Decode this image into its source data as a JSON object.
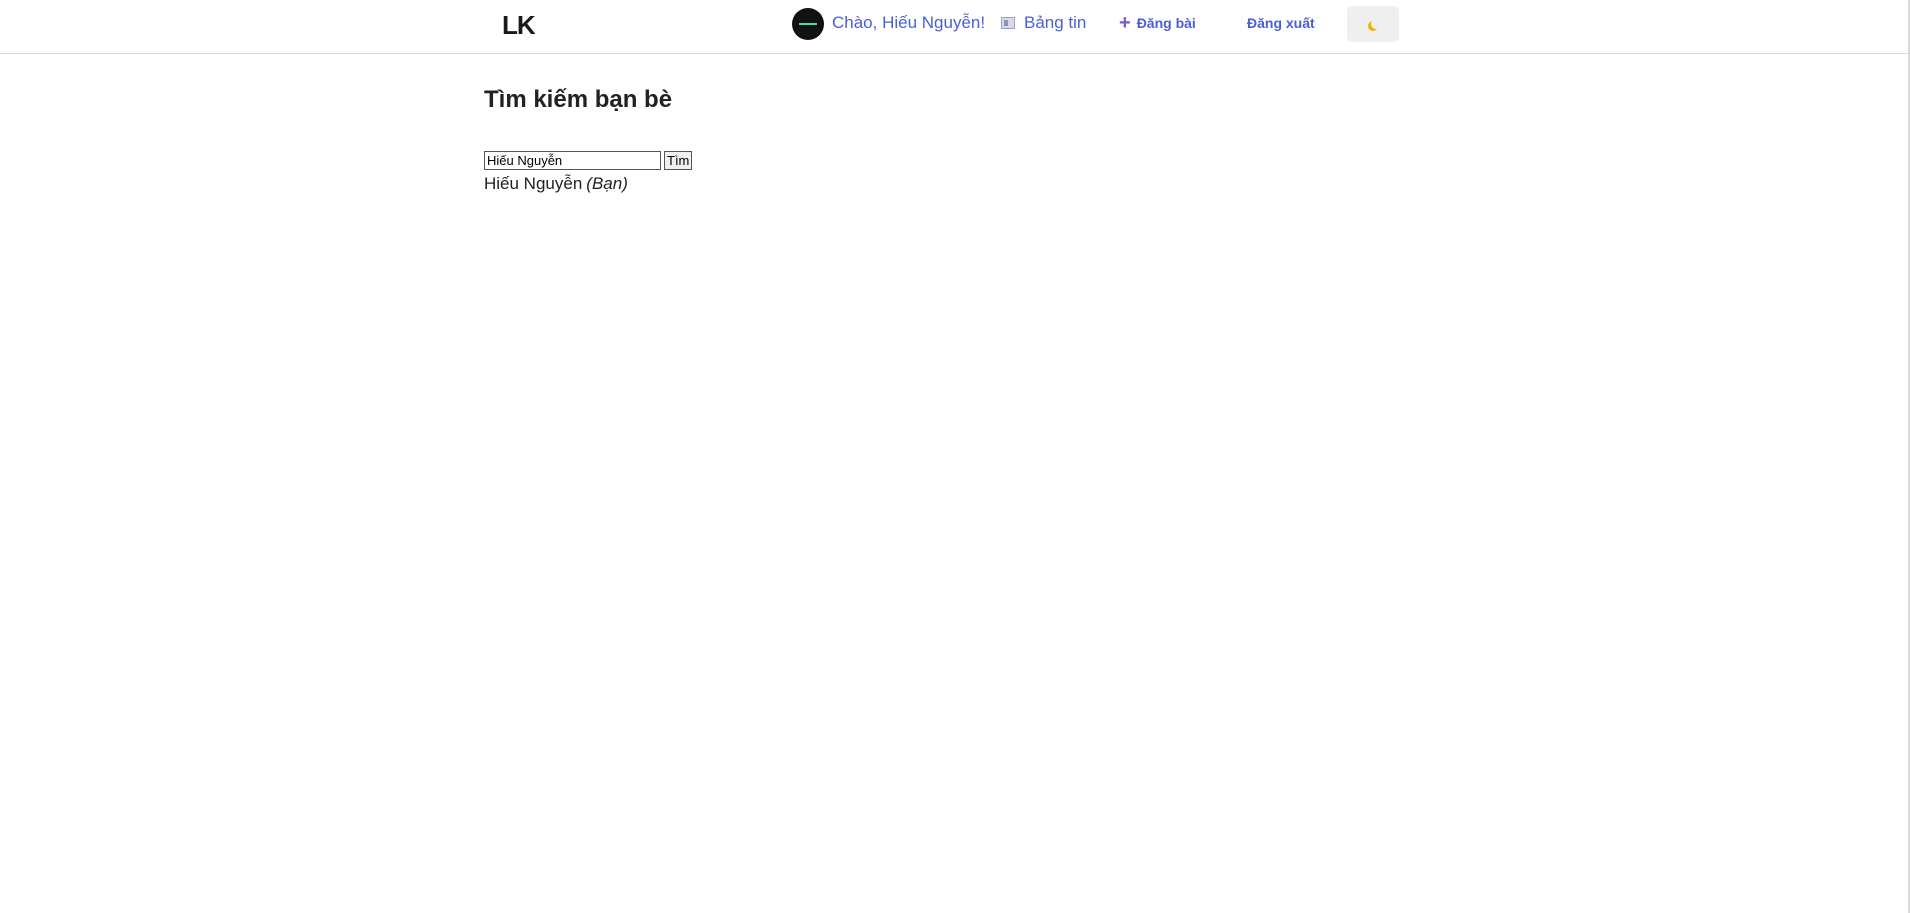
{
  "navbar": {
    "logo": "LK",
    "greeting": "Chào, Hiếu Nguyễn!",
    "feed_label": "Bảng tin",
    "feed_icon": "newspaper-icon",
    "post_label": "Đăng bài",
    "post_icon": "plus-icon",
    "logout_label": "Đăng xuất",
    "theme_icon": "moon-icon",
    "link_color": "#4a5fd6"
  },
  "search": {
    "title": "Tìm kiếm bạn bè",
    "input_value": "Hiếu Nguyễn",
    "button_label": "Tìm"
  },
  "results": [
    {
      "name": "Hiếu Nguyễn",
      "note": "(Bạn)"
    }
  ]
}
